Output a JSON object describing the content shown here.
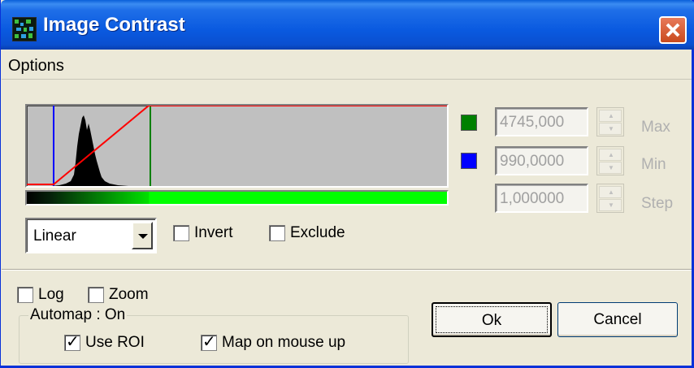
{
  "window": {
    "title": "Image Contrast"
  },
  "menu": {
    "items": [
      "Options"
    ]
  },
  "histogram": {
    "min_marker_color": "#0000ff",
    "max_marker_color": "#008000",
    "mapping_line_color": "#ff0000"
  },
  "range": {
    "max": {
      "label": "Max",
      "value": "4745,000",
      "color": "#008000"
    },
    "min": {
      "label": "Min",
      "value": "990,0000",
      "color": "#0000ff"
    },
    "step": {
      "label": "Step",
      "value": "1,000000"
    }
  },
  "mapping": {
    "selected": "Linear"
  },
  "options": {
    "invert": {
      "label": "Invert",
      "checked": false
    },
    "exclude": {
      "label": "Exclude",
      "checked": false
    },
    "log": {
      "label": "Log",
      "checked": false
    },
    "zoom": {
      "label": "Zoom",
      "checked": false
    }
  },
  "automap": {
    "label": "Automap : On",
    "use_roi": {
      "label": "Use ROI",
      "checked": true
    },
    "map_on_mouse_up": {
      "label": "Map on mouse up",
      "checked": true
    }
  },
  "buttons": {
    "ok": "Ok",
    "cancel": "Cancel"
  },
  "icons": {
    "app": "contrast-app-icon",
    "close": "close-icon",
    "dropdown": "chevron-down-icon"
  }
}
